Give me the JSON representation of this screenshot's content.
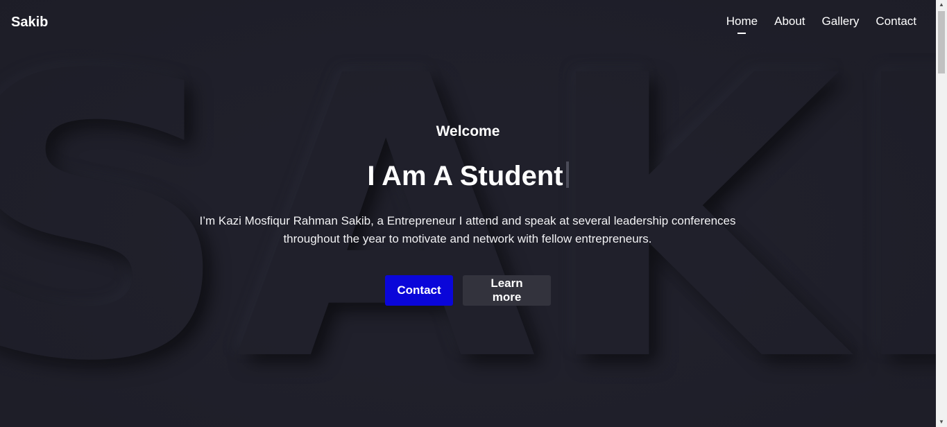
{
  "background_word": "SAKIB",
  "header": {
    "brand": "Sakib",
    "nav": [
      {
        "label": "Home",
        "active": true
      },
      {
        "label": "About",
        "active": false
      },
      {
        "label": "Gallery",
        "active": false
      },
      {
        "label": "Contact",
        "active": false
      }
    ]
  },
  "hero": {
    "welcome": "Welcome",
    "headline": "I Am A Student",
    "lead": "I’m Kazi Mosfiqur Rahman Sakib, a Entrepreneur I attend and speak at several leadership conferences throughout the year to motivate and network with fellow entrepreneurs.",
    "buttons": {
      "primary": "Contact",
      "secondary": "Learn more"
    }
  },
  "colors": {
    "background": "#20202b",
    "primary_button": "#0a06d9",
    "secondary_button": "#33333d",
    "text": "#ffffff"
  },
  "icons": {
    "scroll_up": "chevron-up-icon",
    "scroll_down": "chevron-down-icon"
  }
}
